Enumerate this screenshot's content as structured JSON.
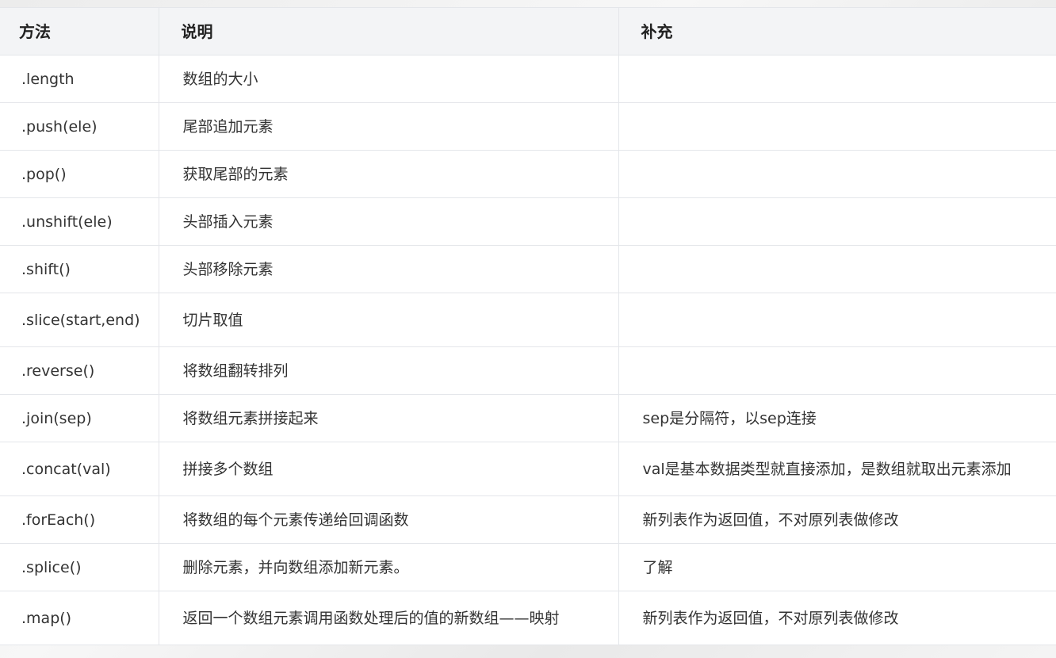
{
  "table": {
    "headers": [
      "方法",
      "说明",
      "补充"
    ],
    "rows": [
      {
        "method": ".length",
        "desc": "数组的大小",
        "note": ""
      },
      {
        "method": ".push(ele)",
        "desc": "尾部追加元素",
        "note": ""
      },
      {
        "method": ".pop()",
        "desc": "获取尾部的元素",
        "note": ""
      },
      {
        "method": ".unshift(ele)",
        "desc": "头部插入元素",
        "note": ""
      },
      {
        "method": ".shift()",
        "desc": "头部移除元素",
        "note": ""
      },
      {
        "method": ".slice(start,end)",
        "desc": "切片取值",
        "note": ""
      },
      {
        "method": ".reverse()",
        "desc": "将数组翻转排列",
        "note": ""
      },
      {
        "method": ".join(sep)",
        "desc": "将数组元素拼接起来",
        "note": "sep是分隔符，以sep连接"
      },
      {
        "method": ".concat(val)",
        "desc": "拼接多个数组",
        "note": "val是基本数据类型就直接添加，是数组就取出元素添加"
      },
      {
        "method": ".forEach()",
        "desc": "将数组的每个元素传递给回调函数",
        "note": "新列表作为返回值，不对原列表做修改"
      },
      {
        "method": ".splice()",
        "desc": "删除元素，并向数组添加新元素。",
        "note": "了解"
      },
      {
        "method": ".map()",
        "desc": "返回一个数组元素调用函数处理后的值的新数组——映射",
        "note": "新列表作为返回值，不对原列表做修改"
      }
    ]
  }
}
